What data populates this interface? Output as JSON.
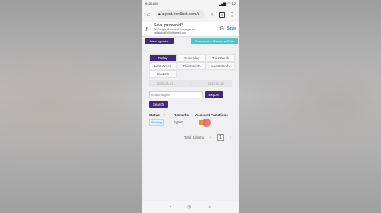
{
  "status_bar": {
    "time": "9:28 AM",
    "battery": "12"
  },
  "browser": {
    "url": "agent.rich9bet.com/a",
    "tab_count": "5"
  },
  "password_prompt": {
    "title": "Save password?",
    "subtitle": "To Google Password Manager for kabacina0908@gmail.com",
    "save_label": "Save"
  },
  "top_buttons": {
    "new_agent": "New Agent +",
    "commission": "Commission/Revenue Shar"
  },
  "date_filters": [
    "Today",
    "Yesterday",
    "This Week",
    "Last Week",
    "This Month",
    "Last Month",
    "Custom"
  ],
  "active_filter": "Today",
  "date_range": {
    "start": "2023-03-01",
    "end": "2023-03-01"
  },
  "search": {
    "placeholder": "Search Agent",
    "export_label": "Export",
    "search_label": "Search"
  },
  "table": {
    "headers": {
      "status": "Status",
      "remarks": "Remarks",
      "functions": "Account Functions"
    },
    "rows": [
      {
        "status": "Pending",
        "remarks": "Agent"
      }
    ]
  },
  "pagination": {
    "total": "Total 1 items",
    "current_page": "1"
  },
  "colors": {
    "primary": "#3f2a75",
    "accent": "#4fc3c8",
    "action": "#f28c1e"
  }
}
